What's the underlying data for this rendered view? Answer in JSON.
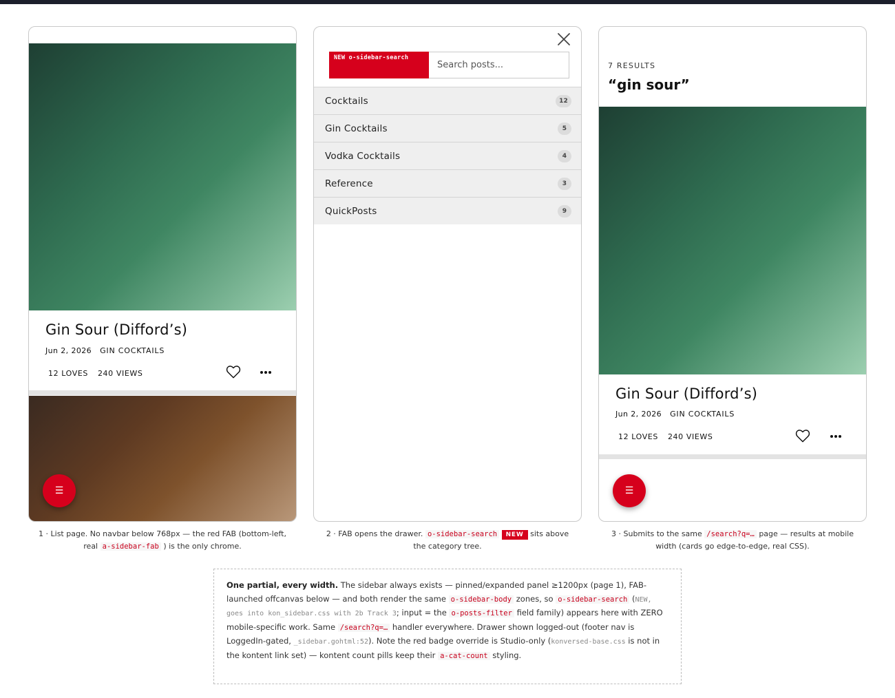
{
  "phone1": {
    "card": {
      "title": "Gin Sour (Difford’s)",
      "date": "Jun 2, 2026",
      "category": "GIN COCKTAILS",
      "loves": "12 LOVES",
      "views": "240 VIEWS"
    },
    "fab_icon": "menu-icon",
    "caption": {
      "line1": "1 · List page. No navbar below 768px — the red FAB (bottom-left,",
      "pre": "real",
      "code": "a-sidebar-fab",
      "post": ") is the only chrome."
    }
  },
  "phone2": {
    "search": {
      "badge": "NEW o-sidebar-search",
      "placeholder": "Search posts..."
    },
    "categories": [
      {
        "label": "Cocktails",
        "count": "12"
      },
      {
        "label": "Gin Cocktails",
        "count": "5"
      },
      {
        "label": "Vodka Cocktails",
        "count": "4"
      },
      {
        "label": "Reference",
        "count": "3"
      },
      {
        "label": "QuickPosts",
        "count": "9"
      }
    ],
    "caption": {
      "pre": "2 · FAB opens the drawer.",
      "code": "o-sidebar-search",
      "tag": "NEW",
      "post": "sits above",
      "line2": "the category tree."
    }
  },
  "phone3": {
    "results_label": "7 RESULTS",
    "query": "“gin sour”",
    "card": {
      "title": "Gin Sour (Difford’s)",
      "date": "Jun 2, 2026",
      "category": "GIN COCKTAILS",
      "loves": "12 LOVES",
      "views": "240 VIEWS"
    },
    "caption": {
      "pre": "3 · Submits to the same",
      "code": "/search?q=…",
      "post": "page — results at mobile",
      "line2": "width (cards go edge-to-edge, real CSS)."
    }
  },
  "note": {
    "lead": "One partial, every width.",
    "t1": " The sidebar always exists — pinned/expanded panel ≥1200px (page 1), FAB-launched offcanvas below — and both render the same ",
    "c1": "o-sidebar-body",
    "t2": " zones, so ",
    "c2": "o-sidebar-search",
    "t3": " (",
    "g1": "NEW, goes into kon_sidebar.css with 2b Track 3",
    "t4": "; input = the ",
    "c3": "o-posts-filter",
    "t5": " field family) appears here with ZERO mobile-specific work. Same ",
    "c4": "/search?q=…",
    "t6": " handler everywhere. Drawer shown logged-out (footer nav is LoggedIn-gated, ",
    "g2": "_sidebar.gohtml:52",
    "t7": "). Note the red badge override is Studio-only (",
    "g3": "konversed-base.css",
    "t8": " is not in the kontent link set) — kontent count pills keep their ",
    "c5": "a-cat-count",
    "t9": " styling."
  },
  "colors": {
    "accent": "#d6001c",
    "topbar": "#1c1f2b"
  }
}
